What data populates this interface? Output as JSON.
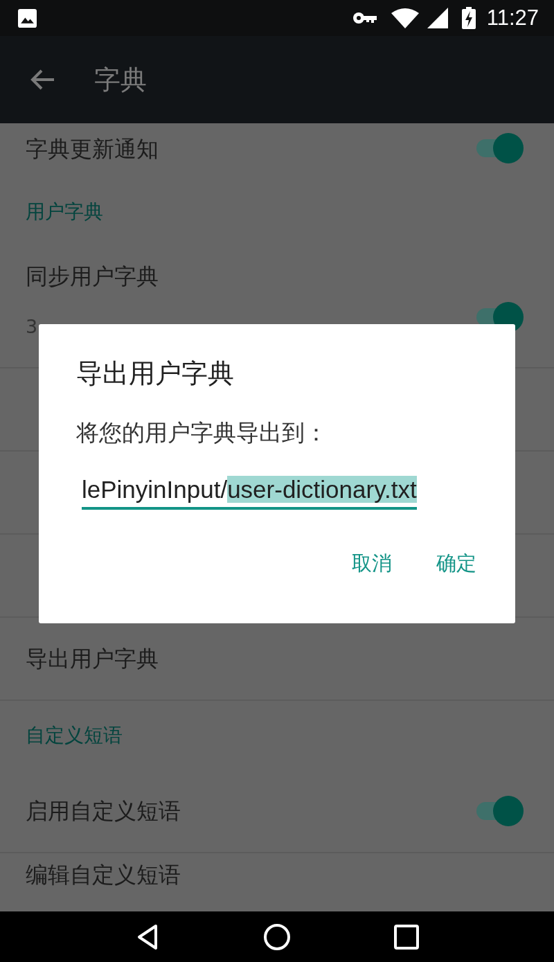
{
  "status_bar": {
    "time": "11:27"
  },
  "app_bar": {
    "title": "字典"
  },
  "settings": [
    {
      "kind": "switch",
      "title": "字典更新通知",
      "on": true
    },
    {
      "kind": "category",
      "title": "用户字典"
    },
    {
      "kind": "switch",
      "title": "同步用户字典",
      "summary": [
        "3"
      ],
      "on": true
    },
    {
      "kind": "item"
    },
    {
      "kind": "item"
    },
    {
      "kind": "item"
    },
    {
      "kind": "item",
      "title": "导出用户字典"
    },
    {
      "kind": "category",
      "title": "自定义短语"
    },
    {
      "kind": "switch",
      "title": "启用自定义短语",
      "on": true
    },
    {
      "kind": "item",
      "title": "编辑自定义短语"
    }
  ],
  "dialog": {
    "title": "导出用户字典",
    "message": "将您的用户字典导出到：",
    "field": {
      "value": "lePinyinInput/",
      "selected_text": "user-dictionary.txt"
    },
    "buttons": [
      "取消",
      "确定"
    ]
  }
}
